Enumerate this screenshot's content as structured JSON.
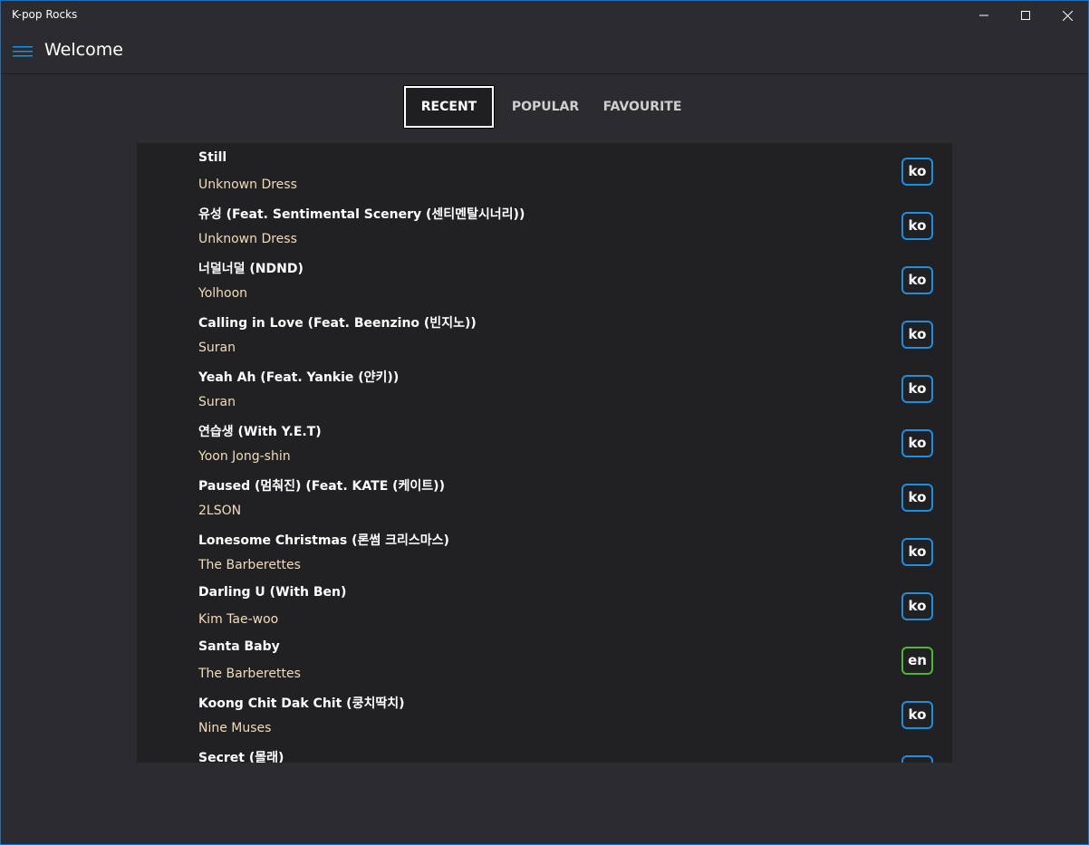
{
  "window": {
    "title": "K-pop Rocks"
  },
  "header": {
    "title": "Welcome"
  },
  "tabs": [
    {
      "label": "RECENT",
      "active": true
    },
    {
      "label": "POPULAR",
      "active": false
    },
    {
      "label": "FAVOURITE",
      "active": false
    }
  ],
  "colors": {
    "accent": "#1d8ee0",
    "ko_badge": "#1d8ee0",
    "en_badge": "#4cb82f",
    "artist_text": "#f2dcbb"
  },
  "songs": [
    {
      "title": "Still",
      "artist": "Unknown Dress",
      "lang": "ko"
    },
    {
      "title": "유성 (Feat. Sentimental Scenery (센티멘탈시너리))",
      "artist": "Unknown Dress",
      "lang": "ko"
    },
    {
      "title": "너덜너덜 (NDND)",
      "artist": "Yolhoon",
      "lang": "ko"
    },
    {
      "title": "Calling in Love (Feat. Beenzino (빈지노))",
      "artist": "Suran",
      "lang": "ko"
    },
    {
      "title": "Yeah Ah (Feat. Yankie (얀키))",
      "artist": "Suran",
      "lang": "ko"
    },
    {
      "title": "연습생 (With Y.E.T)",
      "artist": "Yoon Jong-shin",
      "lang": "ko"
    },
    {
      "title": "Paused (멈춰진) (Feat. KATE (케이트))",
      "artist": "2LSON",
      "lang": "ko"
    },
    {
      "title": "Lonesome Christmas (론썸 크리스마스)",
      "artist": "The Barberettes",
      "lang": "ko"
    },
    {
      "title": "Darling U (With Ben)",
      "artist": "Kim Tae-woo",
      "lang": "ko"
    },
    {
      "title": "Santa Baby",
      "artist": "The Barberettes",
      "lang": "en"
    },
    {
      "title": "Koong Chit Dak Chit (쿵치딱치)",
      "artist": "Nine Muses",
      "lang": "ko"
    },
    {
      "title": "Secret (몰래)",
      "artist": "",
      "lang": "ko"
    }
  ]
}
